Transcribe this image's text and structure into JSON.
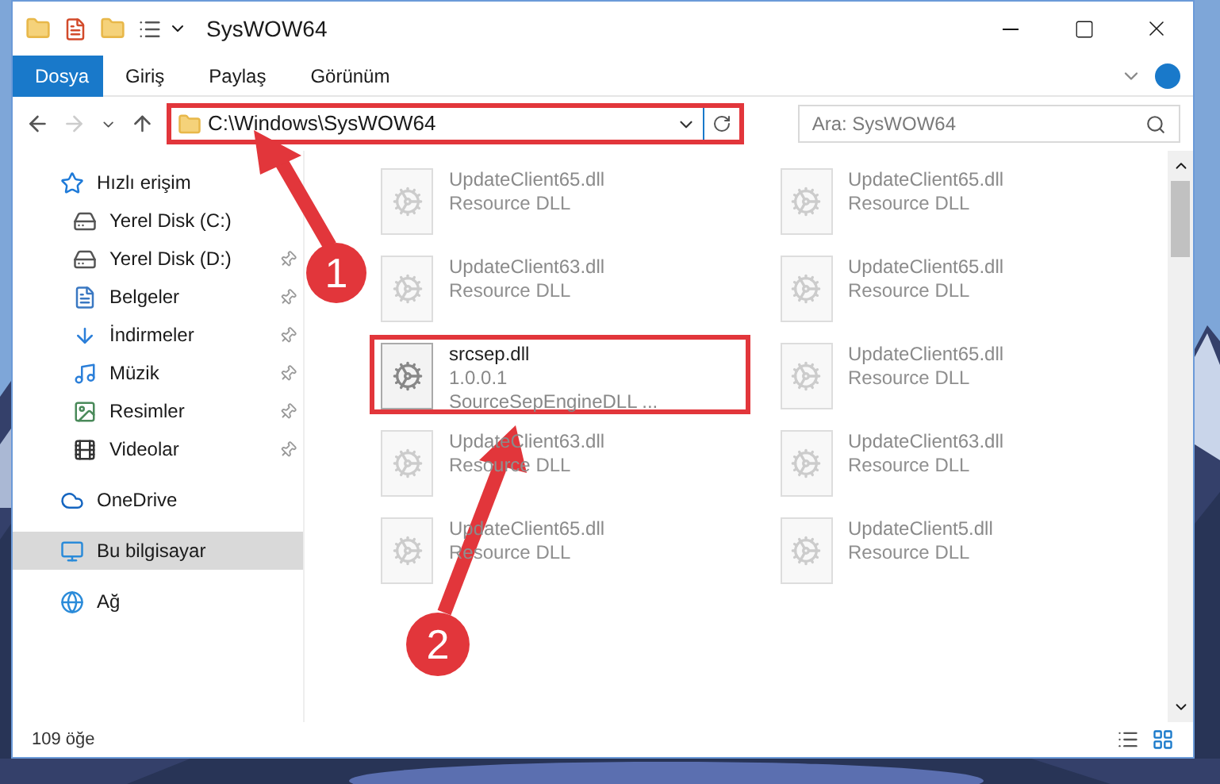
{
  "window": {
    "title": "SysWOW64"
  },
  "ribbon_tabs": [
    {
      "label": "Dosya",
      "selected": true
    },
    {
      "label": "Giriş",
      "selected": false
    },
    {
      "label": "Paylaş",
      "selected": false
    },
    {
      "label": "Görünüm",
      "selected": false
    }
  ],
  "address": {
    "path": "C:\\Windows\\SysWOW64",
    "highlighted": true
  },
  "search": {
    "placeholder": "Ara: SysWOW64"
  },
  "sidebar": {
    "items": [
      {
        "label": "Hızlı erişim",
        "pinned": false,
        "selected": false,
        "children": [
          {
            "label": "Yerel Disk (C:)",
            "pinned": false,
            "selected": false
          },
          {
            "label": "Yerel Disk (D:)",
            "pinned": true,
            "selected": false
          },
          {
            "label": "Belgeler",
            "pinned": true,
            "selected": false
          },
          {
            "label": "İndirmeler",
            "pinned": true,
            "selected": false
          },
          {
            "label": "Müzik",
            "pinned": true,
            "selected": false
          },
          {
            "label": "Resimler",
            "pinned": true,
            "selected": false
          },
          {
            "label": "Videolar",
            "pinned": true,
            "selected": false
          }
        ]
      },
      {
        "label": "OneDrive",
        "pinned": false,
        "selected": false
      },
      {
        "label": "Bu bilgisayar",
        "pinned": false,
        "selected": true
      },
      {
        "label": "Ağ",
        "pinned": false,
        "selected": false
      }
    ]
  },
  "files": [
    {
      "name": "UpdateClient65.dll",
      "detail_1": "Resource DLL",
      "highlighted": false
    },
    {
      "name": "UpdateClient65.dll",
      "detail_1": "Resource DLL",
      "highlighted": false
    },
    {
      "name": "UpdateClient63.dll",
      "detail_1": "Resource DLL",
      "highlighted": false
    },
    {
      "name": "UpdateClient65.dll",
      "detail_1": "Resource DLL",
      "highlighted": false
    },
    {
      "name": "srcsep.dll",
      "detail_1": "1.0.0.1",
      "detail_2": "SourceSepEngineDLL ...",
      "highlighted": true
    },
    {
      "name": "UpdateClient65.dll",
      "detail_1": "Resource DLL",
      "highlighted": false
    },
    {
      "name": "UpdateClient63.dll",
      "detail_1": "Resource DLL",
      "highlighted": false
    },
    {
      "name": "UpdateClient63.dll",
      "detail_1": "Resource DLL",
      "highlighted": false
    },
    {
      "name": "UpdateClient65.dll",
      "detail_1": "Resource DLL",
      "highlighted": false
    },
    {
      "name": "UpdateClient5.dll",
      "detail_1": "Resource DLL",
      "highlighted": false
    }
  ],
  "status_bar": {
    "item_count": "109 öğe"
  },
  "annotations": [
    {
      "label": "1"
    },
    {
      "label": "2"
    }
  ]
}
